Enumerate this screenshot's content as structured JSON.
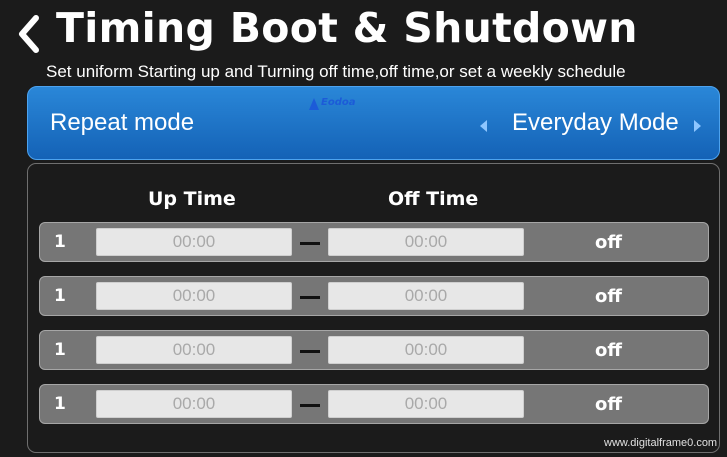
{
  "header": {
    "title": "Timing Boot & Shutdown",
    "subtitle": "Set uniform Starting up and Turning off time,off time,or set a weekly schedule"
  },
  "repeat": {
    "label": "Repeat mode",
    "logo_text": "Eodoa",
    "value": "Everyday Mode"
  },
  "table": {
    "col_up": "Up Time",
    "col_off": "Off Time",
    "rows": [
      {
        "num": "1",
        "up": "00:00",
        "off": "00:00",
        "status": "off"
      },
      {
        "num": "1",
        "up": "00:00",
        "off": "00:00",
        "status": "off"
      },
      {
        "num": "1",
        "up": "00:00",
        "off": "00:00",
        "status": "off"
      },
      {
        "num": "1",
        "up": "00:00",
        "off": "00:00",
        "status": "off"
      }
    ]
  },
  "watermark": "www.digitalframe0.com"
}
